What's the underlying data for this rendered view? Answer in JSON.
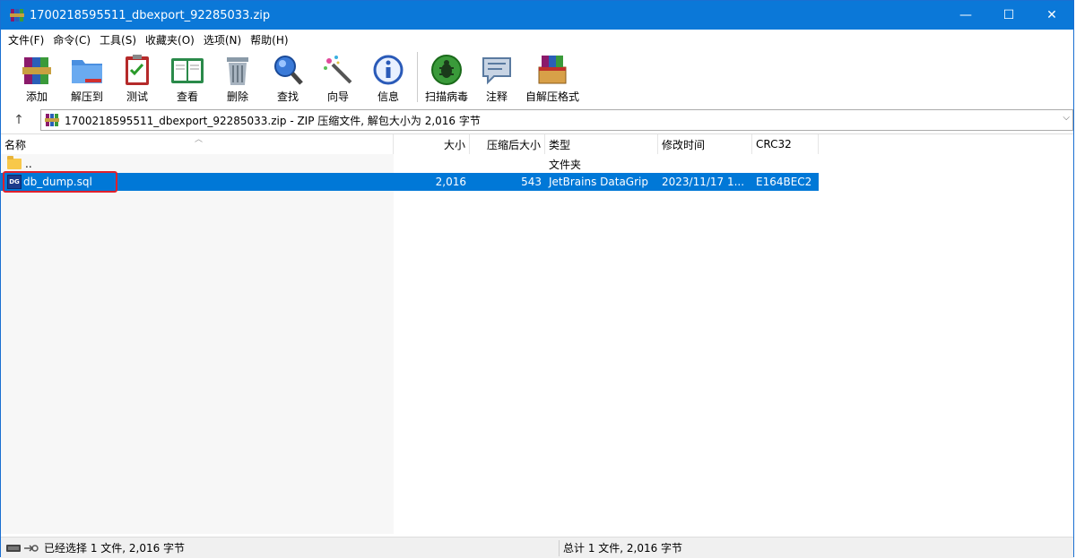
{
  "window": {
    "title": "1700218595511_dbexport_92285033.zip",
    "controls": {
      "minimize": "—",
      "maximize": "☐",
      "close": "✕"
    }
  },
  "menu": [
    "文件(F)",
    "命令(C)",
    "工具(S)",
    "收藏夹(O)",
    "选项(N)",
    "帮助(H)"
  ],
  "toolbar": [
    {
      "label": "添加",
      "icon": "add-archive-icon"
    },
    {
      "label": "解压到",
      "icon": "extract-folder-icon"
    },
    {
      "label": "测试",
      "icon": "test-clipboard-icon"
    },
    {
      "label": "查看",
      "icon": "view-book-icon"
    },
    {
      "label": "删除",
      "icon": "trash-icon"
    },
    {
      "label": "查找",
      "icon": "magnifier-icon"
    },
    {
      "label": "向导",
      "icon": "magic-wand-icon"
    },
    {
      "label": "信息",
      "icon": "info-icon"
    },
    {
      "label": "扫描病毒",
      "icon": "virus-scan-icon"
    },
    {
      "label": "注释",
      "icon": "comment-icon"
    },
    {
      "label": "自解压格式",
      "icon": "sfx-box-icon"
    }
  ],
  "address": {
    "up_glyph": "↑",
    "path": "1700218595511_dbexport_92285033.zip - ZIP 压缩文件, 解包大小为 2,016 字节",
    "dropdown_glyph": "⌵"
  },
  "columns": {
    "name": "名称",
    "size": "大小",
    "packed": "压缩后大小",
    "type": "类型",
    "modified": "修改时间",
    "crc": "CRC32"
  },
  "rows": [
    {
      "name": "..",
      "size": "",
      "packed": "",
      "type": "文件夹",
      "modified": "",
      "crc": "",
      "selected": false
    },
    {
      "name": "db_dump.sql",
      "size": "2,016",
      "packed": "543",
      "type": "JetBrains DataGrip",
      "modified": "2023/11/17 1...",
      "crc": "E164BEC2",
      "selected": true,
      "icon_text": "DG"
    }
  ],
  "status": {
    "left": "已经选择 1 文件, 2,016 字节",
    "right": "总计 1 文件, 2,016 字节"
  },
  "colors": {
    "title_bar": "#0b78d8",
    "selection": "#0078d7",
    "highlight_box": "#e0202c"
  }
}
